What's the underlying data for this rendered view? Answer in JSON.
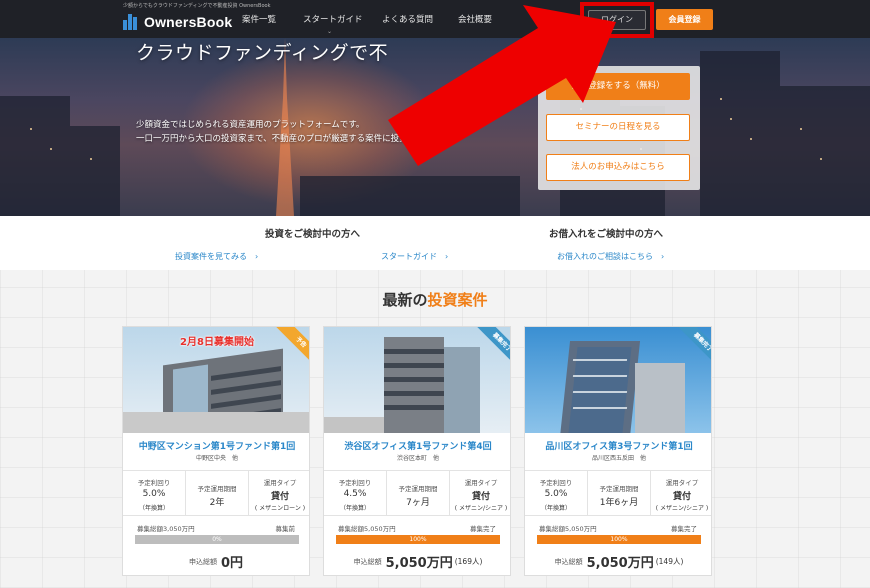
{
  "header": {
    "tagline": "少額からでもクラウドファンディングで不動産投資 OwnersBook",
    "logo_text": "OwnersBook",
    "nav": [
      "案件一覧",
      "スタートガイド",
      "よくある質問",
      "会社概要"
    ],
    "login_label": "ログイン",
    "register_label": "会員登録"
  },
  "hero": {
    "title": "クラウドファンディングで不",
    "sub1": "少額資金ではじめられる資産運用のプラットフォームです。",
    "sub2": "一口一万円から大口の投資家まで、不動産のプロが厳選する案件に投資できます。",
    "cta_primary": "会員登録をする（無料）",
    "cta_seminar": "セミナーの日程を見る",
    "cta_corporate": "法人のお申込みはこちら"
  },
  "band": {
    "invest_heading": "投資をご検討中の方へ",
    "borrow_heading": "お借入れをご検討中の方へ",
    "link_projects": "投資案件を見てみる　›",
    "link_guide": "スタートガイド　›",
    "link_borrow": "お借入れのご相談はこちら　›"
  },
  "section": {
    "title_prefix": "最新の",
    "title_highlight": "投資案件"
  },
  "cards": [
    {
      "banner": "2月8日募集開始",
      "ribbon": "予告",
      "name": "中野区マンション第1号ファンド第1回",
      "location": "中野区中央　他",
      "yield_label": "予定利回り",
      "yield": "5.0%",
      "yield_sub": "（年換算）",
      "period_label": "予定運用期間",
      "period": "2年",
      "type_label": "運用タイプ",
      "type": "貸付",
      "type_sub": "( メザニンローン )",
      "raise_label": "募集総額3,050万円",
      "status": "募集前",
      "progress": 0,
      "progress_text": "0%",
      "amount_label": "申込総額",
      "amount": "0円",
      "count": ""
    },
    {
      "banner": "",
      "ribbon": "募集完了",
      "name": "渋谷区オフィス第1号ファンド第4回",
      "location": "渋谷区本町　他",
      "yield_label": "予定利回り",
      "yield": "4.5%",
      "yield_sub": "（年換算）",
      "period_label": "予定運用期間",
      "period": "7ヶ月",
      "type_label": "運用タイプ",
      "type": "貸付",
      "type_sub": "( メザニン/シニア )",
      "raise_label": "募集総額5,050万円",
      "status": "募集完了",
      "progress": 100,
      "progress_text": "100%",
      "amount_label": "申込総額",
      "amount": "5,050万円",
      "count": "(169人)"
    },
    {
      "banner": "",
      "ribbon": "募集完了",
      "name": "品川区オフィス第3号ファンド第1回",
      "location": "品川区西五反田　他",
      "yield_label": "予定利回り",
      "yield": "5.0%",
      "yield_sub": "（年換算）",
      "period_label": "予定運用期間",
      "period": "1年6ヶ月",
      "type_label": "運用タイプ",
      "type": "貸付",
      "type_sub": "( メザニン/シニア )",
      "raise_label": "募集総額5,050万円",
      "status": "募集完了",
      "progress": 100,
      "progress_text": "100%",
      "amount_label": "申込総額",
      "amount": "5,050万円",
      "count": "(149人)"
    }
  ],
  "colors": {
    "accent": "#f07f18",
    "link": "#2a87c9",
    "header_bg": "#1f2127",
    "annotation_red": "#e10000"
  }
}
